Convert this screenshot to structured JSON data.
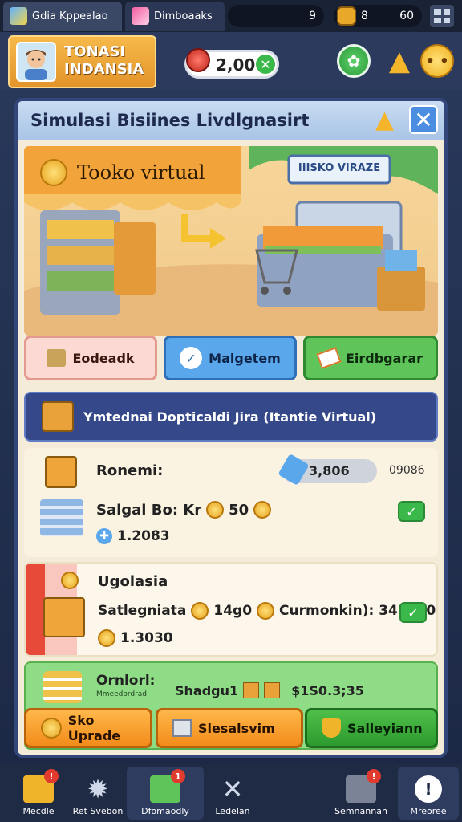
{
  "top_tabs": [
    {
      "label": "Gdia Kppealao"
    },
    {
      "label": "Dimboaaks"
    }
  ],
  "top_status": {
    "left_value": "9",
    "coins_label": "8",
    "gems_value": "60"
  },
  "profile": {
    "name_line1": "TONASI",
    "name_line2": "INDANSIA"
  },
  "currency": {
    "value": "2,00"
  },
  "panel": {
    "title": "Simulasi Bisiines Livdlgnasirt",
    "scene_sign_left": "Tooko virtual",
    "scene_sign_right": "IIISKO VIRAZE"
  },
  "action_buttons": [
    {
      "label": "Eodeadk"
    },
    {
      "label": "Malgetem"
    },
    {
      "label": "Eirdbgarar"
    }
  ],
  "banner": {
    "label": "Ymtednai Dopticaldi Jira (Itantie Virtual)"
  },
  "card1": {
    "title": "Ronemi:",
    "bar_value": "3,806",
    "right_value": "09086",
    "line2_label": "Salgal Bo: Kr",
    "line2_value": "50",
    "line3_value": "1.2083"
  },
  "card2": {
    "title": "Ugolasia",
    "line2_label": "Satlegniata",
    "line2_value": "14g0",
    "line2_extra": "Curmonkin): 343040",
    "line3_value": "1.3030"
  },
  "card3": {
    "title": "Ornlorl:",
    "subtitle": "Mmeedordrad",
    "middle_label": "Shadgu1",
    "value": "$1S0.3;35"
  },
  "bottom_buttons": [
    {
      "label": "Sko Uprade"
    },
    {
      "label": "Slesalsvim"
    },
    {
      "label": "Salleyiann"
    }
  ],
  "nav": [
    {
      "label": "Mecdle",
      "badge": "!"
    },
    {
      "label": "Ret Svebon"
    },
    {
      "label": "Dfomaodly",
      "badge": "1"
    },
    {
      "label": "Ledelan"
    },
    {
      "label": "Semnannan",
      "badge": "!"
    },
    {
      "label": "Mreoree"
    }
  ],
  "colors": {
    "panel_bg": "#f4ecd8",
    "accent_blue": "#4b8de0",
    "green": "#3bb84a",
    "orange": "#f2a33a"
  }
}
